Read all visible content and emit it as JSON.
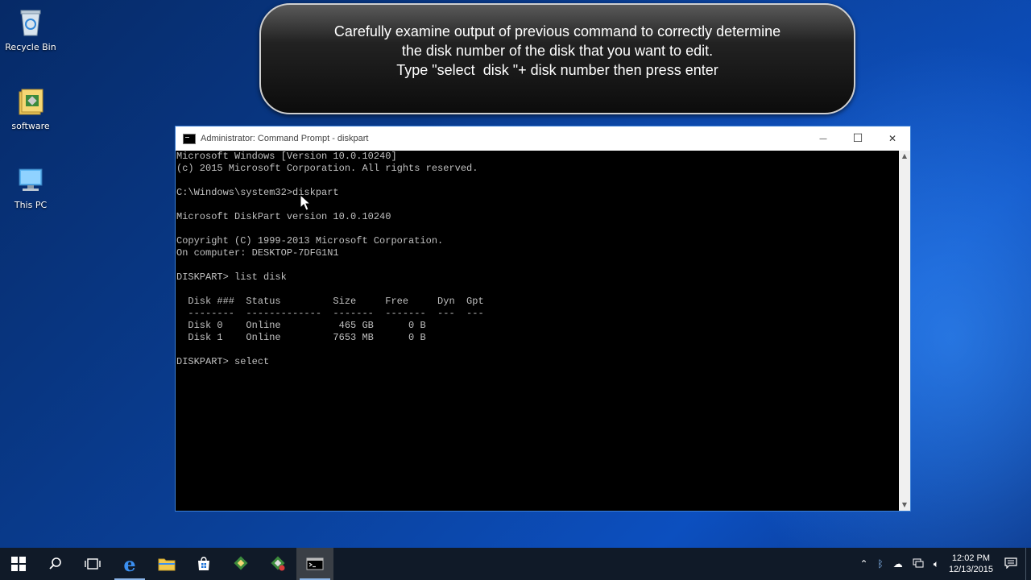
{
  "desktop": {
    "icons": [
      {
        "label": "Recycle Bin"
      },
      {
        "label": "software"
      },
      {
        "label": "This PC"
      }
    ]
  },
  "callout": {
    "text": "Carefully examine output of previous command to correctly determine\nthe disk number of the disk that you want to edit.\nType \"select  disk \"+ disk number then press enter"
  },
  "window": {
    "title": "Administrator: Command Prompt - diskpart",
    "minimize_glyph": "—",
    "maximize_glyph": "☐",
    "close_glyph": "✕"
  },
  "console": {
    "text": "Microsoft Windows [Version 10.0.10240]\n(c) 2015 Microsoft Corporation. All rights reserved.\n\nC:\\Windows\\system32>diskpart\n\nMicrosoft DiskPart version 10.0.10240\n\nCopyright (C) 1999-2013 Microsoft Corporation.\nOn computer: DESKTOP-7DFG1N1\n\nDISKPART> list disk\n\n  Disk ###  Status         Size     Free     Dyn  Gpt\n  --------  -------------  -------  -------  ---  ---\n  Disk 0    Online          465 GB      0 B\n  Disk 1    Online         7653 MB      0 B\n\nDISKPART> select"
  },
  "taskbar": {
    "clock_time": "12:02 PM",
    "clock_date": "12/13/2015"
  },
  "colors": {
    "console_text": "#c0c0c0",
    "taskbar": "#101a28",
    "accent": "#1e73d8"
  }
}
